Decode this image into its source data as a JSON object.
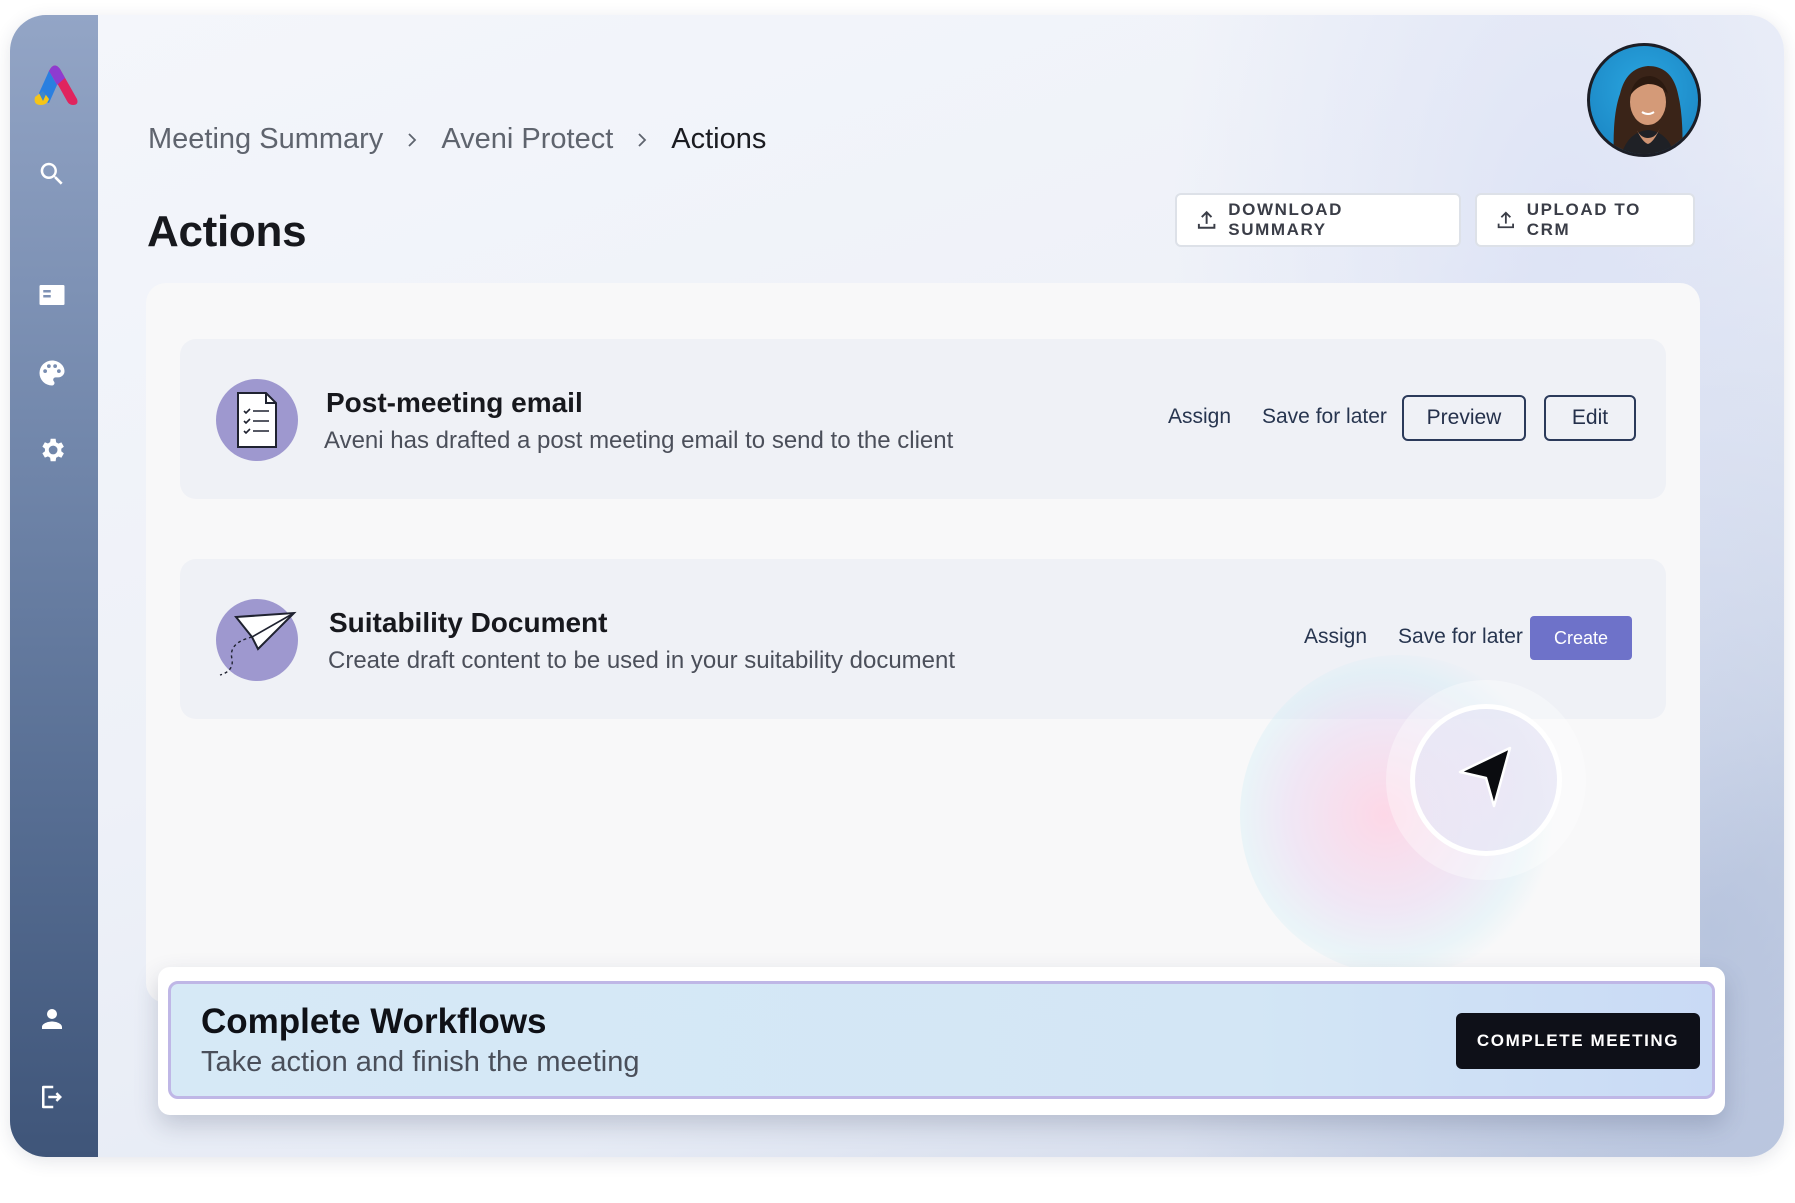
{
  "breadcrumb": {
    "items": [
      "Meeting Summary",
      "Aveni Protect",
      "Actions"
    ]
  },
  "page": {
    "title": "Actions"
  },
  "header": {
    "download_label": "DOWNLOAD SUMMARY",
    "upload_label": "UPLOAD TO CRM"
  },
  "sidebar": {
    "icons": [
      "search-icon",
      "task-list-icon",
      "palette-icon",
      "gear-icon",
      "user-icon",
      "logout-icon"
    ]
  },
  "actions": [
    {
      "title": "Post-meeting email",
      "description": "Aveni has drafted a post meeting email to send to the client",
      "assign_label": "Assign",
      "save_label": "Save for later",
      "preview_label": "Preview",
      "edit_label": "Edit",
      "icon": "document-checklist-icon"
    },
    {
      "title": "Suitability Document",
      "description": "Create draft content to be used in your suitability document",
      "assign_label": "Assign",
      "save_label": "Save for later",
      "create_label": "Create",
      "icon": "paper-plane-icon"
    }
  ],
  "footer": {
    "title": "Complete Workflows",
    "subtitle": "Take action and finish the meeting",
    "complete_label": "COMPLETE MEETING"
  },
  "colors": {
    "accent": "#6e72c9",
    "icon_circle": "#9e98cf",
    "dark_button": "#0e1018"
  }
}
